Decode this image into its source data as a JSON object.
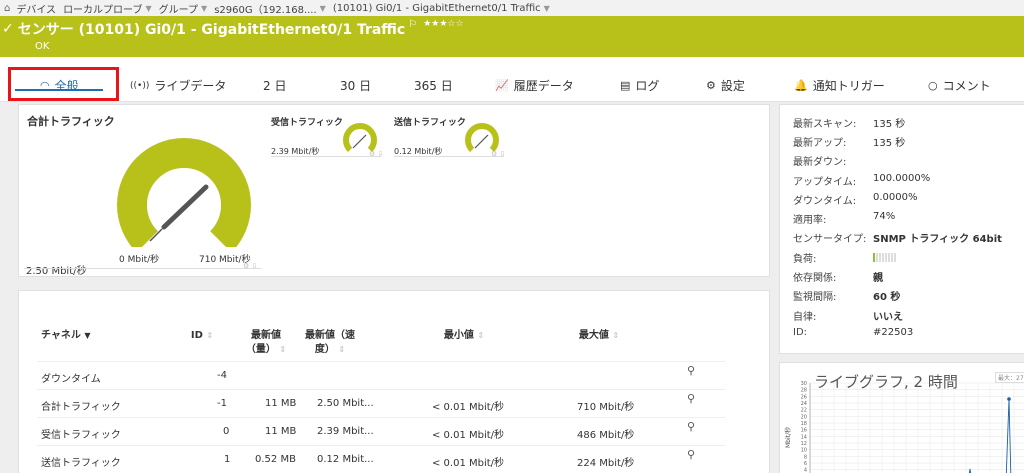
{
  "breadcrumb": {
    "items": [
      {
        "label": "デバイス",
        "dropdown": false
      },
      {
        "label": "ローカルプローブ",
        "dropdown": true
      },
      {
        "label": "グループ",
        "dropdown": true
      },
      {
        "label": "s2960G（192.168....",
        "dropdown": true
      },
      {
        "label": "(10101) Gi0/1 - GigabitEthernet0/1 Traffic",
        "dropdown": true
      }
    ]
  },
  "header": {
    "title": "センサー (10101) Gi0/1 - GigabitEthernet0/1 Traffic",
    "stars": "★★★☆☆",
    "status": "OK",
    "color": "#b8c11a"
  },
  "tabs": [
    {
      "label": "全般",
      "icon": "gauge-icon",
      "active": true
    },
    {
      "label": "ライブデータ",
      "icon": "live-signal-icon",
      "active": false
    },
    {
      "label": "2 日",
      "icon": "",
      "active": false
    },
    {
      "label": "30 日",
      "icon": "",
      "active": false
    },
    {
      "label": "365 日",
      "icon": "",
      "active": false
    },
    {
      "label": "履歴データ",
      "icon": "chart-icon",
      "active": false
    },
    {
      "label": "ログ",
      "icon": "log-icon",
      "active": false
    },
    {
      "label": "設定",
      "icon": "gear-icon",
      "active": false
    },
    {
      "label": "通知トリガー",
      "icon": "bell-icon",
      "active": false
    },
    {
      "label": "コメント",
      "icon": "comment-icon",
      "active": false
    }
  ],
  "gauges": {
    "total": {
      "title": "合計トラフィック",
      "value": "2.50 Mbit/秒",
      "min": "0 Mbit/秒",
      "max": "710 Mbit/秒",
      "fraction": 0.0035
    },
    "rx": {
      "title": "受信トラフィック",
      "value": "2.39 Mbit/秒",
      "fraction": 0.005
    },
    "tx": {
      "title": "送信トラフィック",
      "value": "0.12 Mbit/秒",
      "fraction": 0.0005
    },
    "accent": "#b8c11a"
  },
  "info": {
    "rows": [
      {
        "key": "最新スキャン:",
        "value": "135 秒"
      },
      {
        "key": "最新アップ:",
        "value": "135 秒"
      },
      {
        "key": "最新ダウン:",
        "value": ""
      },
      {
        "key": "アップタイム:",
        "value": "100.0000%"
      },
      {
        "key": "ダウンタイム:",
        "value": "0.0000%"
      },
      {
        "key": "適用率:",
        "value": "74%"
      },
      {
        "key": "センサータイプ:",
        "value": "SNMP トラフィック 64bit"
      },
      {
        "key": "負荷:",
        "value": ""
      },
      {
        "key": "依存関係:",
        "value": "親"
      },
      {
        "key": "監視間隔:",
        "value": "60 秒"
      },
      {
        "key": "自律:",
        "value": "いいえ"
      },
      {
        "key": "ID:",
        "value": "#22503"
      }
    ],
    "load_segments_on": 1,
    "load_segments_total": 8
  },
  "table": {
    "headers": {
      "channel": "チャネル",
      "id": "ID",
      "last_vol_1": "最新値",
      "last_vol_2": "（量）",
      "last_speed_1": "最新値（速",
      "last_speed_2": "度）",
      "min": "最小値",
      "max": "最大値"
    },
    "rows": [
      {
        "channel": "ダウンタイム",
        "id": "-4",
        "vol": "",
        "speed": "",
        "min": "",
        "max": ""
      },
      {
        "channel": "合計トラフィック",
        "id": "-1",
        "vol": "11 MB",
        "speed": "2.50 Mbit...",
        "min": "< 0.01 Mbit/秒",
        "max": "710 Mbit/秒"
      },
      {
        "channel": "受信トラフィック",
        "id": "0",
        "vol": "11 MB",
        "speed": "2.39 Mbit...",
        "min": "< 0.01 Mbit/秒",
        "max": "486 Mbit/秒"
      },
      {
        "channel": "送信トラフィック",
        "id": "1",
        "vol": "0.52 MB",
        "speed": "0.12 Mbit...",
        "min": "< 0.01 Mbit/秒",
        "max": "224 Mbit/秒"
      }
    ]
  },
  "live_graph": {
    "title": "ライブグラフ, 2 時間",
    "legend": "最大：27.9 Mbit",
    "ylabel": "Mbit/秒",
    "yticks": [
      "30",
      "28",
      "26",
      "24",
      "22",
      "20",
      "18",
      "16",
      "14",
      "12",
      "10",
      "8",
      "6",
      "4",
      "2"
    ]
  }
}
